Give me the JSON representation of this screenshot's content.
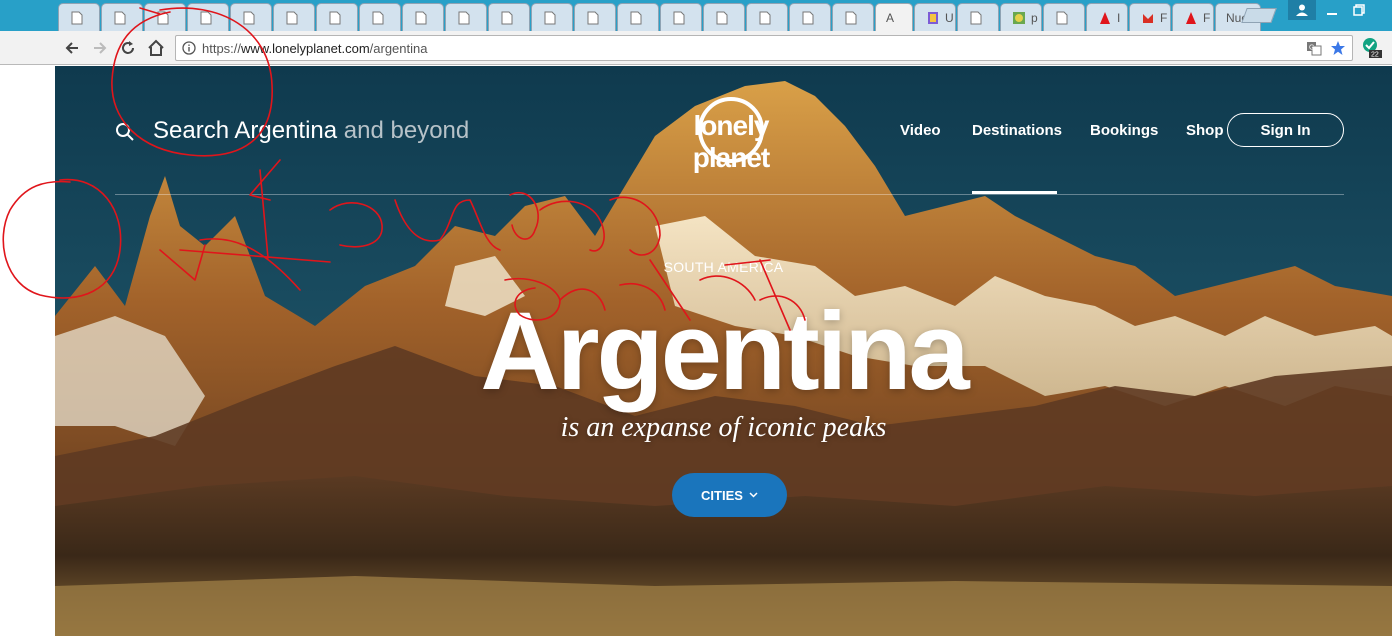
{
  "browser": {
    "tabs": [
      {
        "title": "",
        "icon": "page-icon"
      },
      {
        "title": "",
        "icon": "page-icon"
      },
      {
        "title": "",
        "icon": "page-icon"
      },
      {
        "title": "",
        "icon": "page-icon"
      },
      {
        "title": "",
        "icon": "page-icon"
      },
      {
        "title": "",
        "icon": "page-icon"
      },
      {
        "title": "",
        "icon": "page-icon"
      },
      {
        "title": "",
        "icon": "page-icon"
      },
      {
        "title": "",
        "icon": "page-icon"
      },
      {
        "title": "",
        "icon": "page-icon"
      },
      {
        "title": "",
        "icon": "page-icon"
      },
      {
        "title": "",
        "icon": "page-icon"
      },
      {
        "title": "",
        "icon": "page-icon"
      },
      {
        "title": "",
        "icon": "page-icon"
      },
      {
        "title": "",
        "icon": "page-icon"
      },
      {
        "title": "",
        "icon": "page-icon"
      },
      {
        "title": "",
        "icon": "page-icon"
      },
      {
        "title": "",
        "icon": "page-icon"
      },
      {
        "title": "",
        "icon": "page-icon"
      },
      {
        "title": "A",
        "icon": "",
        "active": true
      },
      {
        "title": "U",
        "icon": "app-icon"
      },
      {
        "title": "",
        "icon": "page-icon"
      },
      {
        "title": "p",
        "icon": "circle-icon"
      },
      {
        "title": "",
        "icon": "page-icon"
      },
      {
        "title": "I",
        "icon": "adobe-icon"
      },
      {
        "title": "F",
        "icon": "gmail-icon"
      },
      {
        "title": "F",
        "icon": "adobe-icon"
      },
      {
        "title": "Nue",
        "icon": ""
      }
    ],
    "url_scheme": "https://",
    "url_host": "www.lonelyplanet.com",
    "url_path": "/argentina",
    "extension_badge": "22",
    "colors": {
      "tabstrip": "#28a0c8",
      "toolbar": "#f2f2f2"
    }
  },
  "header": {
    "search_main": "Search Argentina",
    "search_rest": " and beyond",
    "logo": "lonely planet",
    "nav": [
      "Video",
      "Destinations",
      "Bookings",
      "Shop"
    ],
    "active_nav": "Destinations",
    "signin": "Sign In"
  },
  "hero": {
    "continent": "SOUTH AMERICA",
    "country": "Argentina",
    "tagline": "is an expanse of iconic peaks",
    "cities_button": "CITIES",
    "accent_color": "#1a75bc"
  },
  "annotation": {
    "handwritten_text": "Tiempo de espera",
    "ink_color": "#e0151b"
  }
}
